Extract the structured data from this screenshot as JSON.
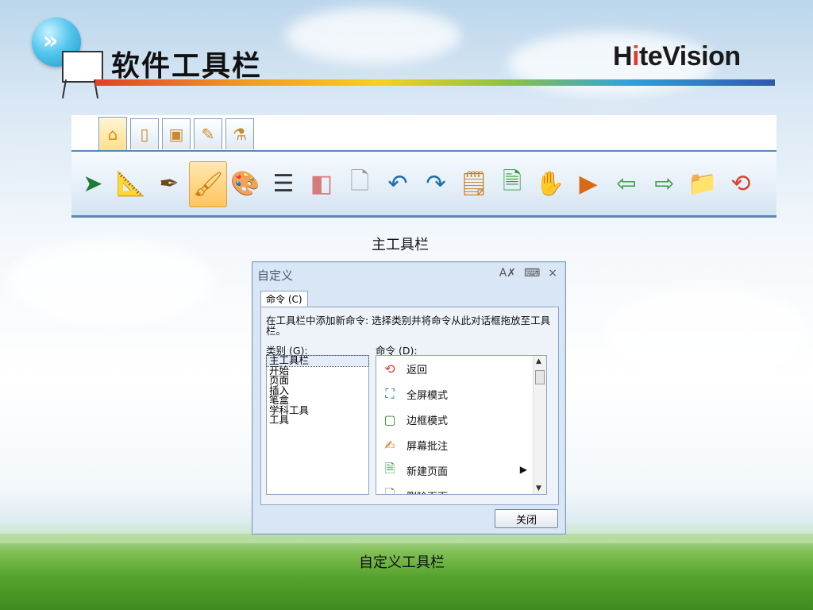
{
  "slide": {
    "title": "软件工具栏",
    "brand": {
      "prefix": "H",
      "i": "i",
      "rest": "teVision"
    },
    "caption_main": "主工具栏",
    "caption_custom": "自定义工具栏"
  },
  "toolbar": {
    "tabs": [
      {
        "icon": "home-icon",
        "glyph": "⌂",
        "active": true
      },
      {
        "icon": "page-icon",
        "glyph": "▯",
        "active": false
      },
      {
        "icon": "insert-icon",
        "glyph": "▣",
        "active": false
      },
      {
        "icon": "pen-holder-icon",
        "glyph": "✎",
        "active": false
      },
      {
        "icon": "subject-tool-icon",
        "glyph": "⚗",
        "active": false
      }
    ],
    "tools": [
      {
        "name": "select-arrow-icon",
        "glyph": "➤"
      },
      {
        "name": "ruler-pen-icon",
        "glyph": "📐"
      },
      {
        "name": "fountain-pen-icon",
        "glyph": "✒"
      },
      {
        "name": "brush-icon",
        "glyph": "🖌"
      },
      {
        "name": "palette-icon",
        "glyph": "🎨"
      },
      {
        "name": "line-style-icon",
        "glyph": "☰"
      },
      {
        "name": "eraser-icon",
        "glyph": "◧"
      },
      {
        "name": "clear-page-icon",
        "glyph": "🗋"
      },
      {
        "name": "undo-icon",
        "glyph": "↶"
      },
      {
        "name": "redo-icon",
        "glyph": "↷"
      },
      {
        "name": "annotate-icon",
        "glyph": "🗒"
      },
      {
        "name": "new-page-icon",
        "glyph": "🗎"
      },
      {
        "name": "hand-icon",
        "glyph": "✋"
      },
      {
        "name": "play-page-icon",
        "glyph": "▶"
      },
      {
        "name": "prev-page-icon",
        "glyph": "⇦"
      },
      {
        "name": "next-page-icon",
        "glyph": "⇨"
      },
      {
        "name": "folder-icon",
        "glyph": "📁"
      },
      {
        "name": "return-icon",
        "glyph": "⟲"
      }
    ],
    "selected_tool_index": 3
  },
  "dialog": {
    "title": "自定义",
    "tab_label": "命令 (C)",
    "description": "在工具栏中添加新命令: 选择类别并将命令从此对话框拖放至工具栏。",
    "category_label": "类别 (G):",
    "command_label": "命令 (D):",
    "categories": [
      "主工具栏",
      "开始",
      "页面",
      "插入",
      "笔盒",
      "学科工具",
      "工具"
    ],
    "selected_category": 0,
    "commands": [
      {
        "label": "返回",
        "icon": "return-icon",
        "glyph": "⟲",
        "color": "#d7422c"
      },
      {
        "label": "全屏模式",
        "icon": "fullscreen-icon",
        "glyph": "⛶",
        "color": "#1c7ac4"
      },
      {
        "label": "边框模式",
        "icon": "border-mode-icon",
        "glyph": "▢",
        "color": "#3b8a2e"
      },
      {
        "label": "屏幕批注",
        "icon": "annotate-icon",
        "glyph": "✍",
        "color": "#c97a14"
      },
      {
        "label": "新建页面",
        "icon": "new-page-icon",
        "glyph": "🗎",
        "color": "#2f9b3c",
        "submenu": true
      },
      {
        "label": "删除页面",
        "icon": "delete-page-icon",
        "glyph": "🗋",
        "color": "#777777"
      }
    ],
    "close_label": "关闭"
  }
}
